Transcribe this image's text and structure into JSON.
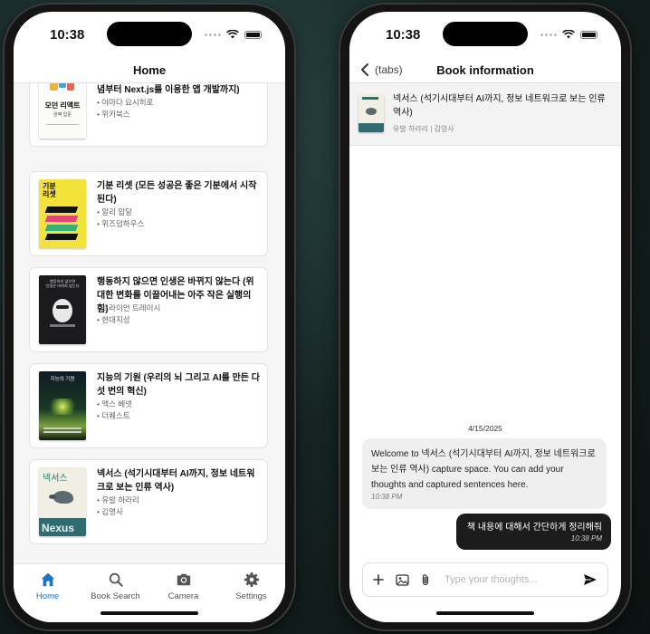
{
  "status": {
    "time": "10:38"
  },
  "home": {
    "nav_title": "Home",
    "books": [
      {
        "title": "모던 리액트 Deep Dive (리액트의 핵심 개념부터 Next.js를 이용한 앱 개발까지)",
        "author": "• 야마다 요시히로",
        "publisher": "• 위키북스",
        "cover_title": "모던 리액트",
        "cover_sub": "완벽 입문"
      },
      {
        "title": "기분 리셋 (모든 성공은 좋은 기분에서 시작된다)",
        "author": "• 알리 압달",
        "publisher": "• 위즈덤하우스",
        "cover_title": "기분\n리셋"
      },
      {
        "title": "행동하지 않으면 인생은 바뀌지 않는다 (위대한 변화를 이끌어내는 아주 작은 실행의 힘)",
        "author": "• 브라이언 트레이시",
        "publisher": "• 현대지성",
        "cover_title": "행동하지 않으면\n인생은 바뀌지 않는다"
      },
      {
        "title": "지능의 기원 (우리의 뇌 그리고 AI를 만든 다섯 번의 혁신)",
        "author": "• 맥스 베넷",
        "publisher": "• 더퀘스트",
        "cover_title": "지능의 기원"
      },
      {
        "title": "넥서스 (석기시대부터 AI까지, 정보 네트워크로 보는 인류 역사)",
        "author": "• 유발 하라리",
        "publisher": "• 김영사",
        "cover_title": "넥서스",
        "cover_sub": "Nexus"
      }
    ],
    "tabs": [
      {
        "label": "Home",
        "icon": "home-icon"
      },
      {
        "label": "Book Search",
        "icon": "search-icon"
      },
      {
        "label": "Camera",
        "icon": "camera-icon"
      },
      {
        "label": "Settings",
        "icon": "gear-icon"
      }
    ]
  },
  "detail": {
    "back_label": "(tabs)",
    "nav_title": "Book information",
    "book_title": "넥서스 (석기시대부터 AI까지, 정보 네트워크로 보는 인류 역사)",
    "book_meta": "유발 하라리 | 김영사",
    "chat_date": "4/15/2025",
    "welcome_msg": "Welcome to 넥서스 (석기시대부터 AI까지, 정보 네트워크로 보는 인류 역사) capture space. You can add your thoughts and captured sentences here.",
    "welcome_time": "10:38 PM",
    "user_msg": "책 내용에 대해서 간단하게 정리해줘",
    "user_time": "10:38 PM",
    "input_placeholder": "Type your thoughts..."
  },
  "colors": {
    "accent": "#1a73c4",
    "user_bubble": "#1c1c1c"
  }
}
